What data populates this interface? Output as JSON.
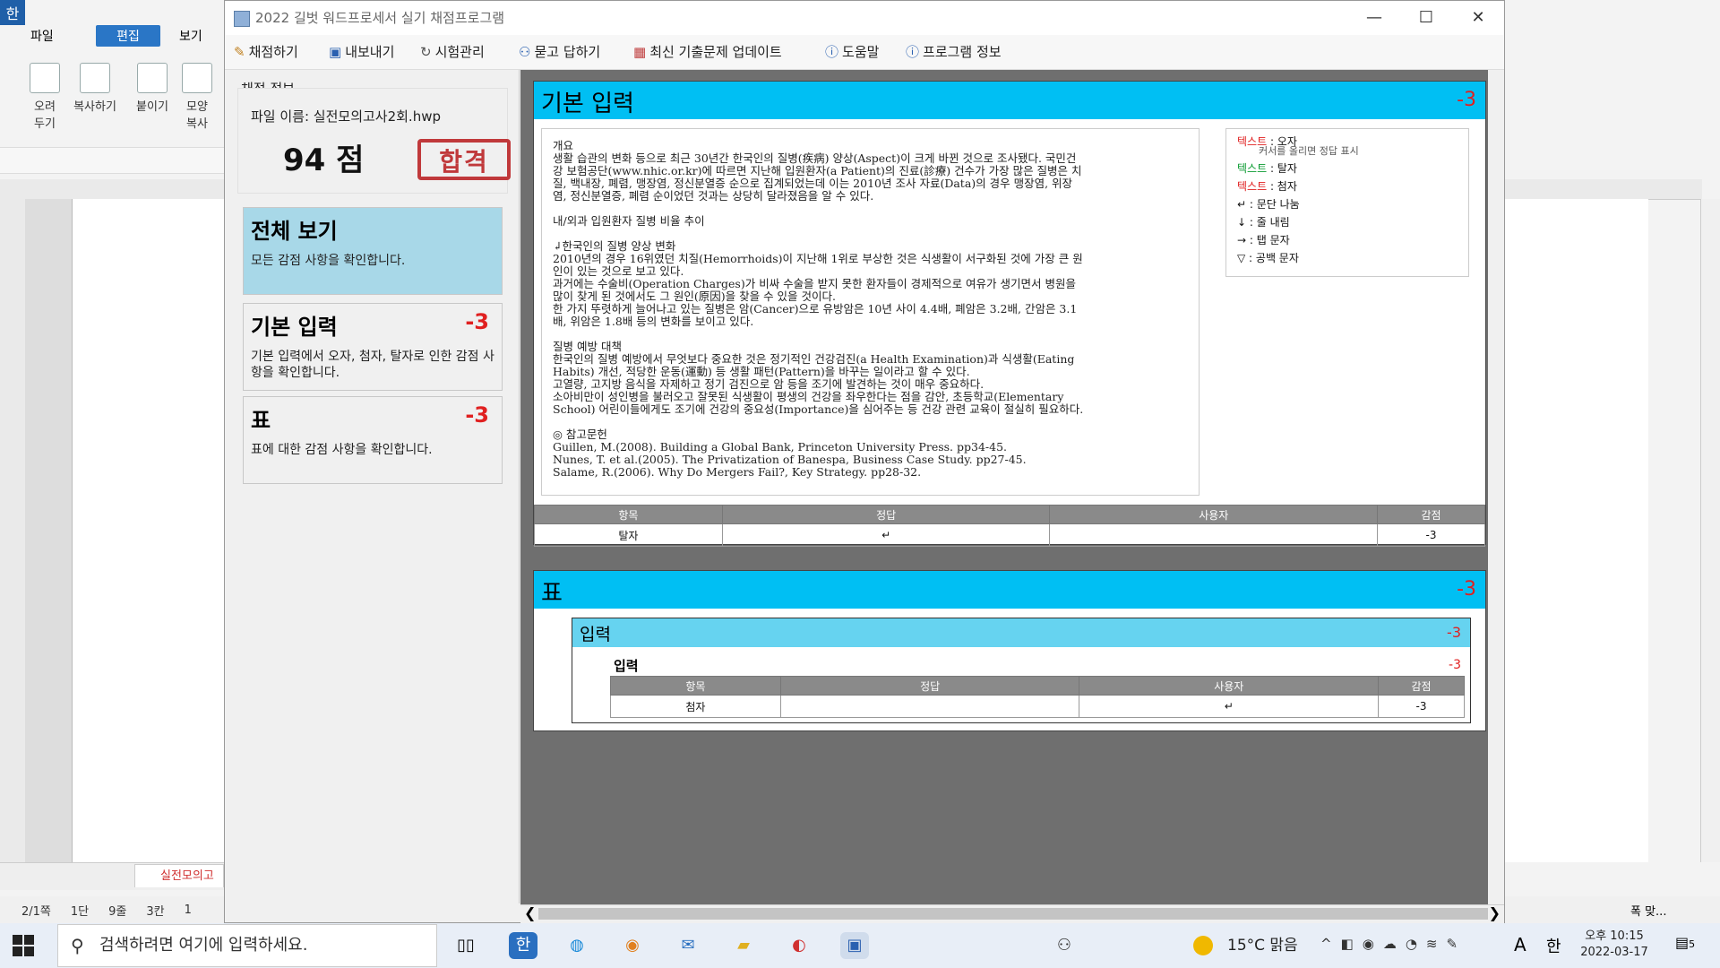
{
  "hwp": {
    "logo": "한",
    "menu_file": "파일",
    "menu_edit": "편집",
    "menu_view": "보기",
    "tools": [
      {
        "label": "오려\n두기"
      },
      {
        "label": "복사하기"
      },
      {
        "label": "붙이기"
      },
      {
        "label": "모양\n복사"
      }
    ],
    "doc_tab": "실전모의고",
    "status": [
      "2/1쪽",
      "1단",
      "9줄",
      "3칸",
      "1"
    ],
    "zoom": "폭 맞..."
  },
  "window": {
    "title": "2022 길벗 워드프로세서 실기 채점프로그램",
    "minimize": "—",
    "maximize": "☐",
    "close": "✕"
  },
  "toolbar": {
    "grade": "채점하기",
    "export": "내보내기",
    "exam_manage": "시험관리",
    "qa": "묻고 답하기",
    "update": "최신 기출문제 업데이트",
    "help": "도움말",
    "about": "프로그램 정보"
  },
  "info": {
    "label": "채점 정보",
    "file_name": "파일 이름: 실전모의고사2회.hwp",
    "score": "94 점",
    "pass": "합격"
  },
  "cards": [
    {
      "title": "전체 보기",
      "penalty": "",
      "desc": "모든 감점 사항을 확인합니다."
    },
    {
      "title": "기본 입력",
      "penalty": "-3",
      "desc": "기본 입력에서 오자, 첨자, 탈자로 인한 감점 사항을 확인합니다."
    },
    {
      "title": "표",
      "penalty": "-3",
      "desc": "표에 대한 감점 사항을 확인합니다."
    }
  ],
  "section_basic": {
    "title": "기본 입력",
    "penalty": "-3",
    "doc_lines": [
      "개요",
      "생활 습관의 변화 등으로 최근 30년간 한국인의 질병(疾病) 양상(Aspect)이 크게 바뀐 것으로 조사됐다. 국민건",
      "강 보험공단(www.nhic.or.kr)에 따르면 지난해 입원환자(a Patient)의 진료(診療) 건수가 가장 많은 질병은 치",
      "질, 백내장, 폐렴, 맹장염, 정신분열증 순으로 집계되었는데 이는 2010년 조사 자료(Data)의 경우 맹장염, 위장",
      "염, 정신분열증, 폐렴 순이었던 것과는 상당히 달라졌음을 알 수 있다.",
      "",
      "내/외과 입원환자 질병 비율 추이",
      "",
      "↲한국인의 질병 양상 변화",
      "2010년의 경우 16위였던 치질(Hemorrhoids)이 지난해 1위로 부상한 것은 식생활이 서구화된 것에 가장 큰 원",
      "인이 있는 것으로 보고 있다.",
      "과거에는 수술비(Operation Charges)가 비싸 수술을 받지 못한 환자들이 경제적으로 여유가 생기면서 병원을",
      "많이 찾게 된 것에서도 그 원인(原因)을 찾을 수 있을 것이다.",
      "한 가지 뚜렷하게 늘어나고 있는 질병은 암(Cancer)으로 유방암은 10년 사이 4.4배, 폐암은 3.2배, 간암은 3.1",
      "배, 위암은 1.8배 등의 변화를 보이고 있다.",
      "",
      "질병 예방 대책",
      "한국인의 질병 예방에서 무엇보다 중요한 것은 정기적인 건강검진(a Health Examination)과 식생활(Eating",
      "Habits) 개선, 적당한 운동(運動) 등 생활 패턴(Pattern)을 바꾸는 일이라고 할 수 있다.",
      "고열량, 고지방 음식을 자제하고 정기 검진으로 암 등을 조기에 발견하는 것이 매우 중요하다.",
      "소아비만이 성인병을 불러오고 잘못된 식생활이 평생의 건강을 좌우한다는 점을 감안, 초등학교(Elementary",
      "School) 어린이들에게도 조기에 건강의 중요성(Importance)을 심어주는 등 건강 관련 교육이 절실히 필요하다.",
      "",
      "◎ 참고문헌",
      "Guillen, M.(2008). Building a Global Bank, Princeton University Press. pp34-45.",
      "Nunes, T. et al.(2005). The Privatization of Banespa, Business Case Study. pp27-45.",
      "Salame, R.(2006). Why Do Mergers Fail?, Key Strategy. pp28-32."
    ],
    "legend": [
      {
        "key": "텍스트",
        "color": "#e02020",
        "text": " : 오자",
        "sub": "커서를 올리면 정답 표시"
      },
      {
        "key": "텍스트",
        "color": "#0a9a30",
        "text": " : 탈자",
        "sub": ""
      },
      {
        "key": "텍스트",
        "color": "#e02020",
        "text": " : 첨자",
        "sub": ""
      },
      {
        "key": "↵",
        "color": "#111111",
        "text": " : 문단 나눔",
        "sub": ""
      },
      {
        "key": "↓",
        "color": "#111111",
        "text": " : 줄 내림",
        "sub": ""
      },
      {
        "key": "→",
        "color": "#111111",
        "text": " : 탭 문자",
        "sub": ""
      },
      {
        "key": "▽",
        "color": "#111111",
        "text": " : 공백 문자",
        "sub": ""
      }
    ],
    "table": {
      "headers": [
        "항목",
        "정답",
        "사용자",
        "감점"
      ],
      "rows": [
        [
          "탈자",
          "↵",
          "",
          "-3"
        ]
      ]
    }
  },
  "section_table": {
    "title": "표",
    "penalty": "-3",
    "sub_title": "입력",
    "sub_penalty": "-3",
    "item_title": "입력",
    "item_penalty": "-3",
    "table": {
      "headers": [
        "항목",
        "정답",
        "사용자",
        "감점"
      ],
      "rows": [
        [
          "첨자",
          "",
          "↵",
          "-3"
        ]
      ]
    }
  },
  "taskbar": {
    "search_placeholder": "검색하려면 여기에 입력하세요.",
    "weather": "15°C  맑음",
    "ime": "한",
    "time": "오후 10:15",
    "date": "2022-03-17",
    "notifications": "5"
  }
}
